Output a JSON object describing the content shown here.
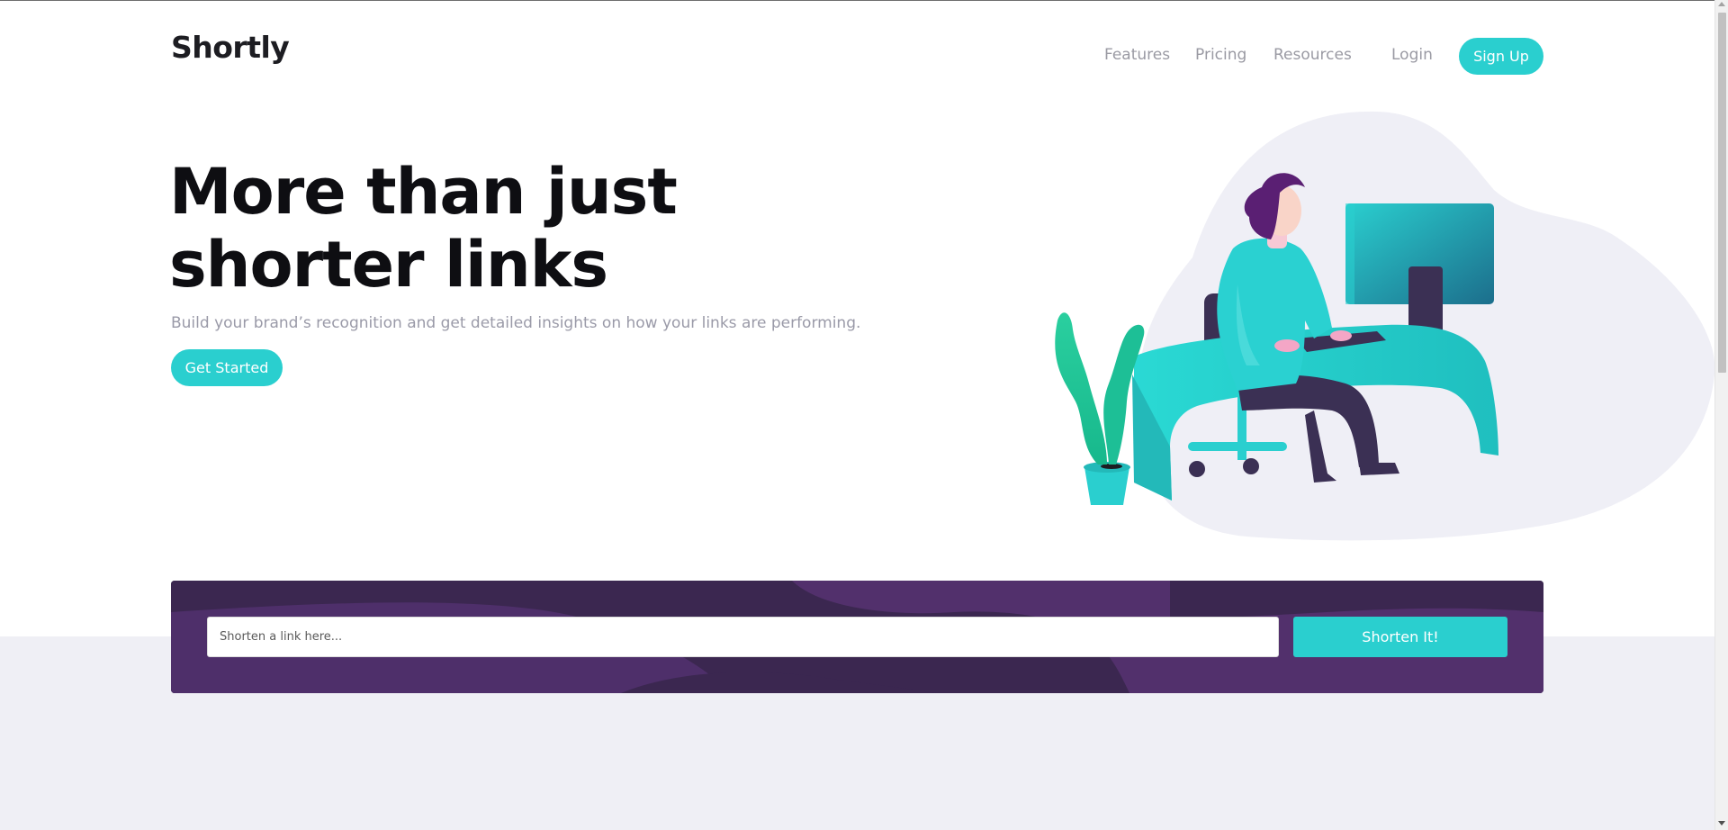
{
  "header": {
    "logo": "Shortly",
    "nav": [
      "Features",
      "Pricing",
      "Resources",
      "Login"
    ],
    "signup_label": "Sign Up"
  },
  "hero": {
    "title": "More than just shorter links",
    "subtitle": "Build your brand’s recognition and get detailed insights on how your links are performing.",
    "cta_label": "Get Started",
    "illustration": "person-working-at-desk-illustration"
  },
  "shorten": {
    "placeholder": "Shorten a link here...",
    "button_label": "Shorten It!"
  },
  "colors": {
    "primary": "#2acfcf",
    "dark_violet": "#3b3054",
    "grayish_violet": "#9e9aa7",
    "light_gray_bg": "#efeff5"
  }
}
